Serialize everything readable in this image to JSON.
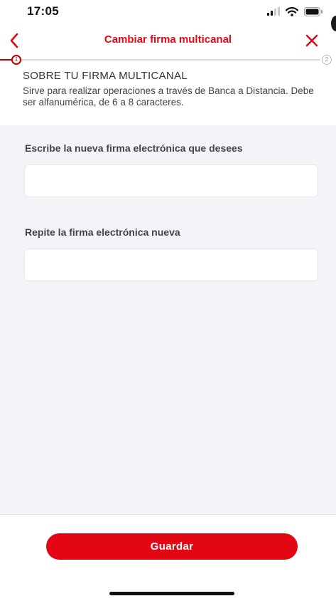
{
  "status_bar": {
    "time": "17:05"
  },
  "header": {
    "title": "Cambiar firma multicanal",
    "back_icon": "chevron-left-icon",
    "close_icon": "close-icon",
    "accent_color": "#e30613"
  },
  "stepper": {
    "current_step": "1",
    "total_step": "2"
  },
  "info": {
    "title": "SOBRE TU FIRMA MULTICANAL",
    "description": "Sirve para realizar operaciones a través de Banca a Distancia. Debe ser alfanumérica, de 6 a 8 caracteres."
  },
  "form": {
    "new_signature_label": "Escribe la nueva firma electrónica que desees",
    "new_signature_value": "",
    "repeat_signature_label": "Repite la firma electrónica nueva",
    "repeat_signature_value": ""
  },
  "actions": {
    "save_label": "Guardar"
  }
}
